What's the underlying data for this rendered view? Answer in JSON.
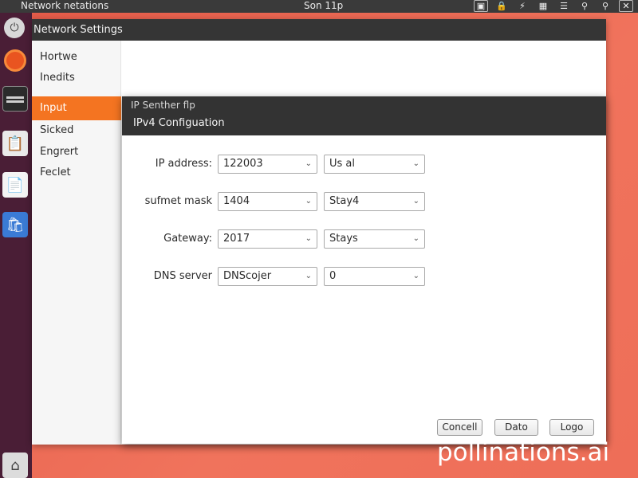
{
  "topbar": {
    "app_title": "Network netations",
    "clock": "Son 11p",
    "tray_icons": [
      "display-icon",
      "lock-icon",
      "bolt-icon",
      "grid-icon",
      "menu-icon",
      "search-icon",
      "search-icon",
      "close-icon"
    ]
  },
  "launcher": {
    "icons": [
      "dash-icon",
      "ubuntu-icon",
      "terminal-icon",
      "system-monitor-icon",
      "document-icon",
      "app-store-icon",
      "home-icon"
    ]
  },
  "window": {
    "title": "Network Settings"
  },
  "sidebar": {
    "items": [
      {
        "label": "Hortwe"
      },
      {
        "label": "Inedits"
      },
      {
        "label": "Input"
      },
      {
        "label": "Sicked"
      },
      {
        "label": "Engrert"
      },
      {
        "label": "Feclet"
      }
    ],
    "active_index": 2
  },
  "dialog": {
    "subtitle": "IP Senther flp",
    "title": "IPv4 Configuation",
    "rows": [
      {
        "label": "IP address:",
        "value": "122003",
        "option": "Us al"
      },
      {
        "label": "sufmet mask",
        "value": "1404",
        "option": "Stay4"
      },
      {
        "label": "Gateway:",
        "value": "2017",
        "option": "Stays"
      },
      {
        "label": "DNS server",
        "value": "DNScojer",
        "option": "0"
      }
    ],
    "buttons": {
      "cancel": "Concell",
      "data": "Dato",
      "logo": "Logo"
    }
  },
  "watermark": "pollinations.ai",
  "colors": {
    "accent": "#f47421",
    "desktop": "#ee6e58",
    "launcher": "#4a1e36",
    "titlebar": "#353535"
  }
}
